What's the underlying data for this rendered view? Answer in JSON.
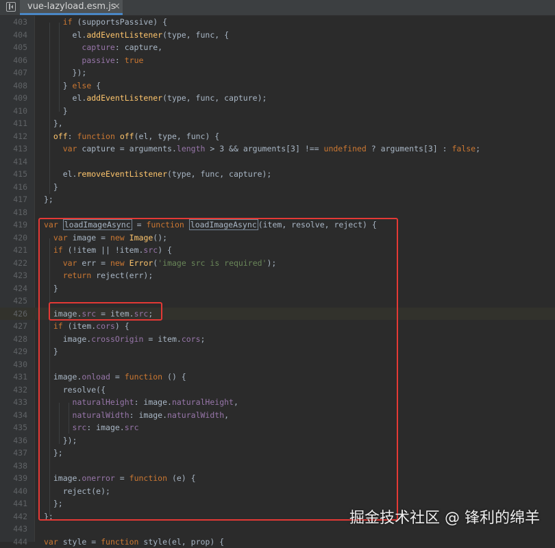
{
  "tab": {
    "filename": "vue-lazyload.esm.js",
    "close": "×"
  },
  "icons": {
    "sidebar_toggle": "sidebar-toggle-icon",
    "tab_close": "close-icon"
  },
  "colors": {
    "background": "#2b2b2b",
    "keyword": "#cc7832",
    "function": "#ffc66d",
    "property": "#9876aa",
    "string": "#6a8759",
    "highlight_box": "#e53935"
  },
  "editor": {
    "highlighted_line": "426",
    "lines": [
      {
        "n": "403",
        "code": "    if (supportsPassive) {"
      },
      {
        "n": "404",
        "code": "      el.addEventListener(type, func, {"
      },
      {
        "n": "405",
        "code": "        capture: capture,"
      },
      {
        "n": "406",
        "code": "        passive: true"
      },
      {
        "n": "407",
        "code": "      });"
      },
      {
        "n": "408",
        "code": "    } else {"
      },
      {
        "n": "409",
        "code": "      el.addEventListener(type, func, capture);"
      },
      {
        "n": "410",
        "code": "    }"
      },
      {
        "n": "411",
        "code": "  },"
      },
      {
        "n": "412",
        "code": "  off: function off(el, type, func) {"
      },
      {
        "n": "413",
        "code": "    var capture = arguments.length > 3 && arguments[3] !== undefined ? arguments[3] : false;"
      },
      {
        "n": "414",
        "code": ""
      },
      {
        "n": "415",
        "code": "    el.removeEventListener(type, func, capture);"
      },
      {
        "n": "416",
        "code": "  }"
      },
      {
        "n": "417",
        "code": "};"
      },
      {
        "n": "418",
        "code": ""
      },
      {
        "n": "419",
        "code": "var loadImageAsync = function loadImageAsync(item, resolve, reject) {"
      },
      {
        "n": "420",
        "code": "  var image = new Image();"
      },
      {
        "n": "421",
        "code": "  if (!item || !item.src) {"
      },
      {
        "n": "422",
        "code": "    var err = new Error('image src is required');"
      },
      {
        "n": "423",
        "code": "    return reject(err);"
      },
      {
        "n": "424",
        "code": "  }"
      },
      {
        "n": "425",
        "code": ""
      },
      {
        "n": "426",
        "code": "  image.src = item.src;"
      },
      {
        "n": "427",
        "code": "  if (item.cors) {"
      },
      {
        "n": "428",
        "code": "    image.crossOrigin = item.cors;"
      },
      {
        "n": "429",
        "code": "  }"
      },
      {
        "n": "430",
        "code": ""
      },
      {
        "n": "431",
        "code": "  image.onload = function () {"
      },
      {
        "n": "432",
        "code": "    resolve({"
      },
      {
        "n": "433",
        "code": "      naturalHeight: image.naturalHeight,"
      },
      {
        "n": "434",
        "code": "      naturalWidth: image.naturalWidth,"
      },
      {
        "n": "435",
        "code": "      src: image.src"
      },
      {
        "n": "436",
        "code": "    });"
      },
      {
        "n": "437",
        "code": "  };"
      },
      {
        "n": "438",
        "code": ""
      },
      {
        "n": "439",
        "code": "  image.onerror = function (e) {"
      },
      {
        "n": "440",
        "code": "    reject(e);"
      },
      {
        "n": "441",
        "code": "  };"
      },
      {
        "n": "442",
        "code": "};"
      },
      {
        "n": "443",
        "code": ""
      },
      {
        "n": "444",
        "code": "var style = function style(el, prop) {"
      }
    ]
  },
  "watermark": "掘金技术社区 @ 锋利的绵羊"
}
